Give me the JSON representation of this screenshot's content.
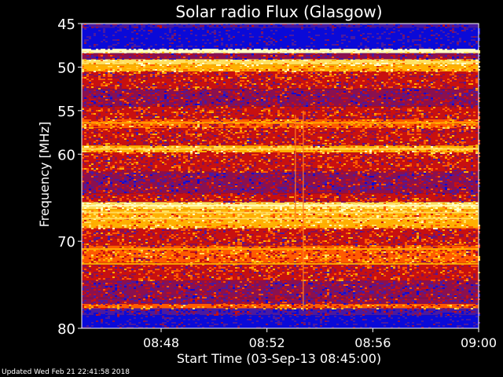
{
  "chart_data": {
    "type": "heatmap",
    "title": "Solar radio Flux (Glasgow)",
    "ylabel": "Frequency [MHz]",
    "xlabel": "Start Time (03-Sep-13 08:45:00)",
    "ylim": [
      45,
      80
    ],
    "y_ticks": [
      "45",
      "50",
      "55",
      "60",
      "70",
      "80"
    ],
    "y_tick_values": [
      45,
      50,
      55,
      60,
      70,
      80
    ],
    "xlim_minutes": [
      0,
      15
    ],
    "x_ticks": [
      "08:48",
      "08:52",
      "08:56",
      "09:00"
    ],
    "x_tick_minutes": [
      3,
      7,
      11,
      15
    ],
    "colormap": [
      "#0a0ad8",
      "#4a1aa0",
      "#8a1050",
      "#c81010",
      "#ff5a00",
      "#ffb000",
      "#ffe060",
      "#ffffc8"
    ],
    "bands": [
      {
        "from": 45.0,
        "to": 45.5,
        "level": 1
      },
      {
        "from": 45.5,
        "to": 47.9,
        "level": 0
      },
      {
        "from": 47.9,
        "to": 48.4,
        "level": 7
      },
      {
        "from": 48.4,
        "to": 49.1,
        "level": 2
      },
      {
        "from": 49.1,
        "to": 49.7,
        "level": 6
      },
      {
        "from": 49.7,
        "to": 50.5,
        "level": 5
      },
      {
        "from": 50.5,
        "to": 52.5,
        "level": 3
      },
      {
        "from": 52.5,
        "to": 54.5,
        "level": 2
      },
      {
        "from": 54.5,
        "to": 56.0,
        "level": 3
      },
      {
        "from": 56.0,
        "to": 57.0,
        "level": 4
      },
      {
        "from": 57.0,
        "to": 59.0,
        "level": 3
      },
      {
        "from": 59.0,
        "to": 59.8,
        "level": 5
      },
      {
        "from": 59.8,
        "to": 62.0,
        "level": 3
      },
      {
        "from": 62.0,
        "to": 64.5,
        "level": 2
      },
      {
        "from": 64.5,
        "to": 65.5,
        "level": 3
      },
      {
        "from": 65.5,
        "to": 66.3,
        "level": 6
      },
      {
        "from": 66.3,
        "to": 68.5,
        "level": 5
      },
      {
        "from": 68.5,
        "to": 70.5,
        "level": 3
      },
      {
        "from": 70.5,
        "to": 72.5,
        "level": 4
      },
      {
        "from": 72.5,
        "to": 74.5,
        "level": 3
      },
      {
        "from": 74.5,
        "to": 76.5,
        "level": 2
      },
      {
        "from": 76.5,
        "to": 77.2,
        "level": 2
      },
      {
        "from": 77.2,
        "to": 77.7,
        "level": 4
      },
      {
        "from": 77.7,
        "to": 78.5,
        "level": 1
      },
      {
        "from": 78.5,
        "to": 80.0,
        "level": 0
      }
    ],
    "bright_lines": [
      {
        "freq": 48.1,
        "level": 7
      },
      {
        "freq": 49.4,
        "level": 6
      },
      {
        "freq": 50.1,
        "level": 5
      },
      {
        "freq": 56.4,
        "level": 5
      },
      {
        "freq": 59.4,
        "level": 6
      },
      {
        "freq": 65.9,
        "level": 7
      },
      {
        "freq": 66.7,
        "level": 6
      },
      {
        "freq": 67.4,
        "level": 6
      },
      {
        "freq": 68.0,
        "level": 5
      },
      {
        "freq": 70.9,
        "level": 5
      },
      {
        "freq": 72.6,
        "level": 5
      }
    ],
    "bursts": [
      {
        "minute": 8.05,
        "from": 55.5,
        "to": 67.5
      },
      {
        "minute": 8.35,
        "from": 55.0,
        "to": 78.0
      }
    ]
  },
  "footer": "Updated Wed Feb 21 22:41:58 2018"
}
